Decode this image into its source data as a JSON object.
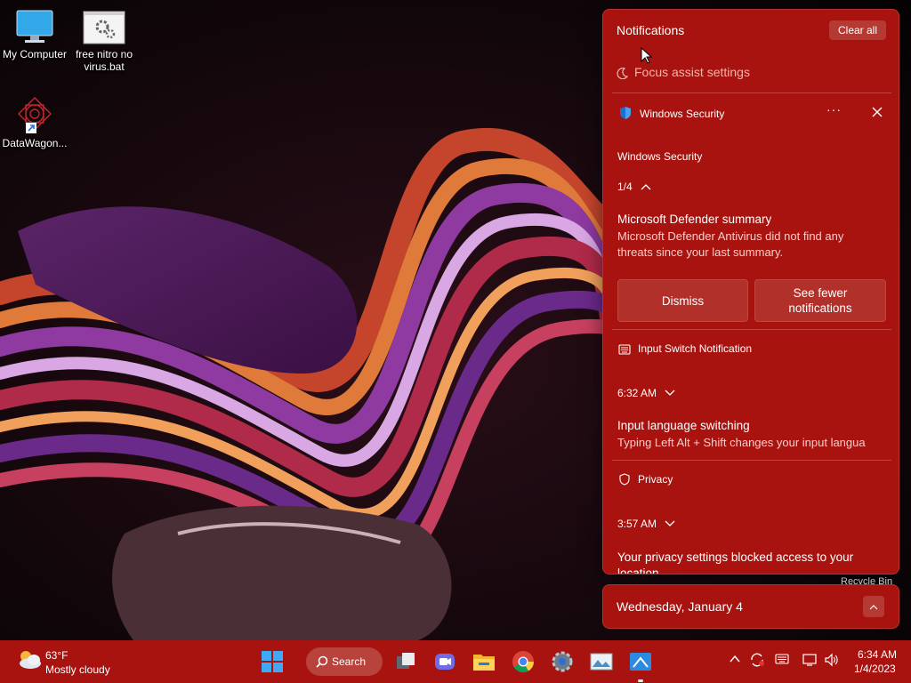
{
  "desktop": {
    "icons": [
      {
        "label_line1": "My Computer",
        "label_line2": "",
        "icon": "monitor-icon"
      },
      {
        "label_line1": "free nitro no",
        "label_line2": "virus.bat",
        "icon": "batch-file-icon"
      },
      {
        "label_line1": "DataWagon...",
        "label_line2": "",
        "icon": "shortcut-icon"
      }
    ],
    "recycle_bin": "Recycle Bin"
  },
  "notification_center": {
    "title": "Notifications",
    "clear_all": "Clear all",
    "focus_assist": "Focus assist settings",
    "groups": [
      {
        "app": "Windows Security",
        "header": "Windows Security",
        "counter": "1/4",
        "title": "Microsoft Defender summary",
        "body_line1": "Microsoft Defender Antivirus did not find any",
        "body_line2": "threats since your last summary.",
        "actions": [
          {
            "label": "Dismiss"
          },
          {
            "label_line1": "See fewer",
            "label_line2": "notifications"
          }
        ],
        "more": "···"
      },
      {
        "app": "Input Switch Notification",
        "time": "6:32 AM",
        "title": "Input language switching",
        "body_line1": "Typing Left Alt + Shift changes your input langua"
      },
      {
        "app": "Privacy",
        "time": "3:57 AM",
        "body_line1": "Your privacy settings blocked access to your",
        "body_line2": "location."
      }
    ]
  },
  "calendar": {
    "date": "Wednesday, January 4"
  },
  "taskbar": {
    "weather": {
      "temp": "63°F",
      "desc": "Mostly cloudy"
    },
    "search_label": "Search",
    "apps": [
      "start-icon",
      "search-icon",
      "task-view-icon",
      "chat-icon",
      "file-explorer-icon",
      "chrome-icon",
      "settings-icon",
      "photos-icon",
      "app-icon"
    ],
    "clock": {
      "time": "6:34 AM",
      "date": "1/4/2023"
    }
  },
  "colors": {
    "accent": "#a8130f",
    "accent_light": "#b53a33"
  }
}
